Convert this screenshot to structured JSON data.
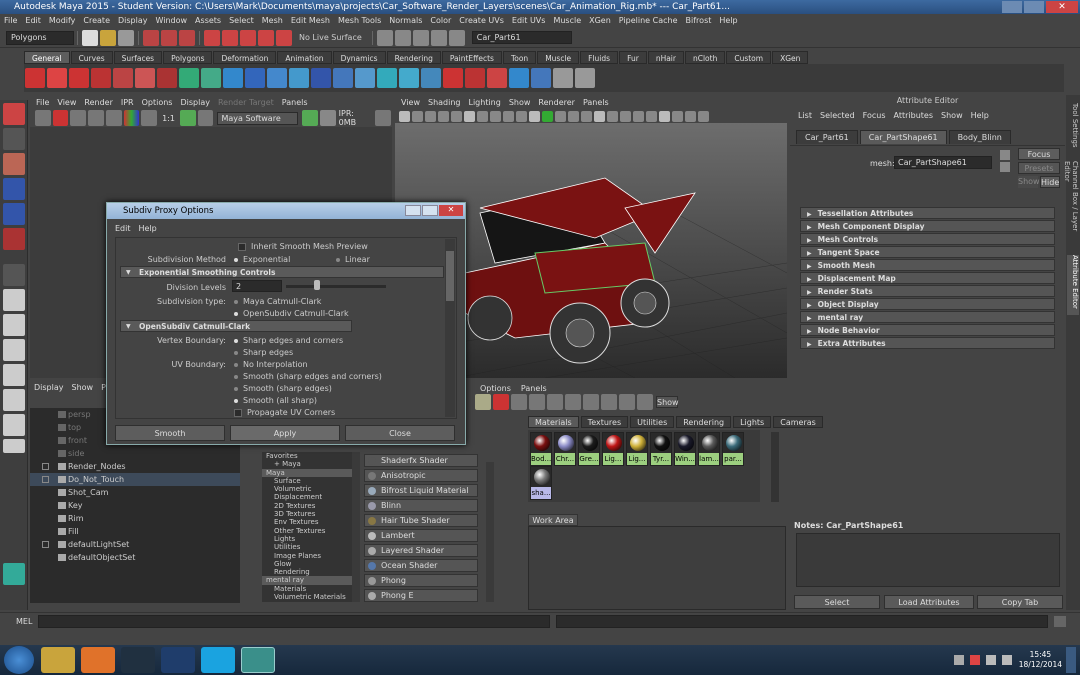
{
  "window": {
    "title": "Autodesk Maya 2015 - Student Version: C:\\Users\\Mark\\Documents\\maya\\projects\\Car_Software_Render_Layers\\scenes\\Car_Animation_Rig.mb* --- Car_Part61..."
  },
  "main_menu": [
    "File",
    "Edit",
    "Modify",
    "Create",
    "Display",
    "Window",
    "Assets",
    "Select",
    "Mesh",
    "Edit Mesh",
    "Mesh Tools",
    "Normals",
    "Color",
    "Create UVs",
    "Edit UVs",
    "Muscle",
    "XGen",
    "Pipeline Cache",
    "Bifrost",
    "Help"
  ],
  "status_line": {
    "mode": "Polygons",
    "live_surface": "No Live Surface",
    "object_field": "Car_Part61"
  },
  "shelf_tabs": [
    "General",
    "Curves",
    "Surfaces",
    "Polygons",
    "Deformation",
    "Animation",
    "Dynamics",
    "Rendering",
    "PaintEffects",
    "Toon",
    "Muscle",
    "Fluids",
    "Fur",
    "nHair",
    "nCloth",
    "Custom",
    "XGen"
  ],
  "shelf_active": "General",
  "render_view": {
    "menu": [
      "File",
      "View",
      "Render",
      "IPR",
      "Options",
      "Display",
      "Render Target",
      "Panels"
    ],
    "ratio": "1:1",
    "renderer": "Maya Software",
    "ipr": "IPR: 0MB"
  },
  "viewport": {
    "menu": [
      "View",
      "Shading",
      "Lighting",
      "Show",
      "Renderer",
      "Panels"
    ]
  },
  "attribute_editor": {
    "title": "Attribute Editor",
    "menu": [
      "List",
      "Selected",
      "Focus",
      "Attributes",
      "Show",
      "Help"
    ],
    "tabs": [
      "Car_Part61",
      "Car_PartShape61",
      "Body_Blinn"
    ],
    "active_tab": "Car_PartShape61",
    "mesh_label": "mesh:",
    "mesh_value": "Car_PartShape61",
    "focus": "Focus",
    "presets": "Presets",
    "show": "Show",
    "hide": "Hide",
    "sections": [
      "Tessellation Attributes",
      "Mesh Component Display",
      "Mesh Controls",
      "Tangent Space",
      "Smooth Mesh",
      "Displacement Map",
      "Render Stats",
      "Object Display",
      "mental ray",
      "Node Behavior",
      "Extra Attributes"
    ],
    "notes": "Notes:  Car_PartShape61",
    "buttons": [
      "Select",
      "Load Attributes",
      "Copy Tab"
    ]
  },
  "side_tabs": [
    "Tool Settings",
    "Channel Box / Layer Editor",
    "Attribute Editor"
  ],
  "outliner": {
    "menu": [
      "Display",
      "Show",
      "Pa"
    ],
    "items": [
      {
        "label": "persp",
        "dim": true,
        "expand": false
      },
      {
        "label": "top",
        "dim": true,
        "expand": false
      },
      {
        "label": "front",
        "dim": true,
        "expand": false
      },
      {
        "label": "side",
        "dim": true,
        "expand": false
      },
      {
        "label": "Render_Nodes",
        "dim": false,
        "expand": true
      },
      {
        "label": "Do_Not_Touch",
        "dim": false,
        "expand": true
      },
      {
        "label": "Shot_Cam",
        "dim": false,
        "expand": false
      },
      {
        "label": "Key",
        "dim": false,
        "expand": false
      },
      {
        "label": "Rim",
        "dim": false,
        "expand": false
      },
      {
        "label": "Fill",
        "dim": false,
        "expand": false
      },
      {
        "label": "defaultLightSet",
        "dim": false,
        "expand": true
      },
      {
        "label": "defaultObjectSet",
        "dim": false,
        "expand": false
      }
    ]
  },
  "hypershade": {
    "menu": [
      "Options",
      "Panels"
    ],
    "show_button": "Show",
    "tree": [
      "Favorites",
      "+ Maya",
      "Maya",
      "Surface",
      "Volumetric",
      "Displacement",
      "2D Textures",
      "3D Textures",
      "Env Textures",
      "Other Textures",
      "Lights",
      "Utilities",
      "Image Planes",
      "Glow",
      "Rendering",
      "mental ray",
      "Materials",
      "Volumetric Materials"
    ],
    "shaders": [
      "Shaderfx Shader",
      "Anisotropic",
      "Bifrost Liquid Material",
      "Blinn",
      "Hair Tube Shader",
      "Lambert",
      "Layered Shader",
      "Ocean Shader",
      "Phong",
      "Phong E"
    ],
    "tabs": [
      "Materials",
      "Textures",
      "Utilities",
      "Rendering",
      "Lights",
      "Cameras"
    ],
    "active_tab": "Materials",
    "swatches": [
      {
        "label": "Bod...",
        "color": "#7a0f0f"
      },
      {
        "label": "Chr...",
        "color": "#8c8cc8"
      },
      {
        "label": "Gre...",
        "color": "#1c1c1c"
      },
      {
        "label": "Lig...",
        "color": "#c01616"
      },
      {
        "label": "Lig...",
        "color": "#d0b23a"
      },
      {
        "label": "Tyr...",
        "color": "#111111"
      },
      {
        "label": "Win...",
        "color": "#1a1a2a"
      },
      {
        "label": "lam...",
        "color": "#5a5a5a"
      },
      {
        "label": "par...",
        "color": "#3b6b7a"
      },
      {
        "label": "sha...",
        "color": "#7a7a7a"
      }
    ],
    "work_area": "Work Area"
  },
  "dialog": {
    "title": "Subdiv Proxy Options",
    "menu": [
      "Edit",
      "Help"
    ],
    "inherit": "Inherit Smooth Mesh Preview",
    "method_label": "Subdivision Method",
    "method_options": [
      "Exponential",
      "Linear"
    ],
    "frame1": "Exponential Smoothing Controls",
    "levels_label": "Division Levels",
    "levels_value": "2",
    "type_label": "Subdivision type:",
    "type_options": [
      "Maya Catmull-Clark",
      "OpenSubdiv Catmull-Clark"
    ],
    "frame2": "OpenSubdiv Catmull-Clark",
    "vb_label": "Vertex Boundary:",
    "vb_options": [
      "Sharp edges and corners",
      "Sharp edges"
    ],
    "uv_label": "UV Boundary:",
    "uv_options": [
      "No Interpolation",
      "Smooth (sharp edges and corners)",
      "Smooth (sharp edges)",
      "Smooth (all sharp)"
    ],
    "propagate": "Propagate UV Corners",
    "buttons": [
      "Smooth",
      "Apply",
      "Close"
    ]
  },
  "mel_label": "MEL",
  "taskbar": {
    "time": "15:45",
    "date": "18/12/2014"
  }
}
